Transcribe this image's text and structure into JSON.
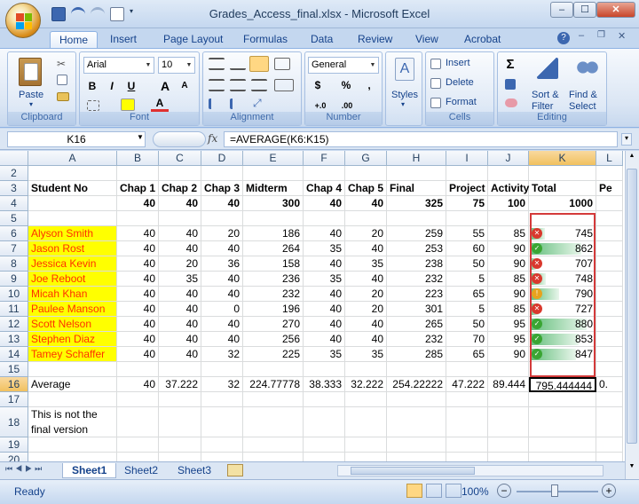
{
  "window": {
    "title": "Grades_Access_final.xlsx - Microsoft Excel",
    "minimize": "–",
    "maximize": "☐",
    "close": "✕"
  },
  "ribbon_tabs": [
    "Home",
    "Insert",
    "Page Layout",
    "Formulas",
    "Data",
    "Review",
    "View",
    "Acrobat"
  ],
  "ribbon": {
    "clipboard": {
      "paste": "Paste",
      "label": "Clipboard"
    },
    "font": {
      "name": "Arial",
      "size": "10",
      "label": "Font",
      "bold": "B",
      "italic": "I",
      "underline": "U",
      "grow": "A",
      "shrink": "A",
      "color_letter": "A"
    },
    "alignment": {
      "label": "Alignment"
    },
    "number": {
      "format": "General",
      "currency": "$",
      "percent": "%",
      "comma": ",",
      "inc": "+.0",
      "dec": ".00",
      "label": "Number"
    },
    "styles": {
      "styles": "Styles"
    },
    "cells": {
      "insert": "Insert",
      "delete": "Delete",
      "format": "Format",
      "label": "Cells"
    },
    "editing": {
      "sigma": "Σ",
      "sort": "Sort &",
      "sort2": "Filter",
      "find": "Find &",
      "find2": "Select",
      "label": "Editing"
    }
  },
  "formula_bar": {
    "name_box": "K16",
    "fx": "fx",
    "formula": "=AVERAGE(K6:K15)"
  },
  "columns": [
    "A",
    "B",
    "C",
    "D",
    "E",
    "F",
    "G",
    "H",
    "I",
    "J",
    "K",
    "L"
  ],
  "rows": [
    "2",
    "3",
    "4",
    "5",
    "6",
    "7",
    "8",
    "9",
    "10",
    "11",
    "12",
    "13",
    "14",
    "15",
    "16",
    "17",
    "18",
    "19",
    "20"
  ],
  "header_row": {
    "student": "Student No",
    "c1": "Chap 1",
    "c2": "Chap 2",
    "c3": "Chap 3",
    "mid": "Midterm",
    "c4": "Chap 4",
    "c5": "Chap 5",
    "final": "Final",
    "proj": "Project",
    "act": "Activity",
    "total": "Total",
    "pe": "Pe"
  },
  "max_row": [
    "40",
    "40",
    "40",
    "300",
    "40",
    "40",
    "325",
    "75",
    "100",
    "1000"
  ],
  "students": [
    {
      "name": "Alyson Smith",
      "v": [
        "40",
        "40",
        "20",
        "186",
        "40",
        "20",
        "259",
        "55",
        "85",
        "745"
      ],
      "icon": "red"
    },
    {
      "name": "Jason Rost",
      "v": [
        "40",
        "40",
        "40",
        "264",
        "35",
        "40",
        "253",
        "60",
        "90",
        "862"
      ],
      "icon": "green"
    },
    {
      "name": "Jessica Kevin",
      "v": [
        "40",
        "20",
        "36",
        "158",
        "40",
        "35",
        "238",
        "50",
        "90",
        "707"
      ],
      "icon": "red"
    },
    {
      "name": "Joe Reboot",
      "v": [
        "40",
        "35",
        "40",
        "236",
        "35",
        "40",
        "232",
        "5",
        "85",
        "748"
      ],
      "icon": "red"
    },
    {
      "name": "Micah Khan",
      "v": [
        "40",
        "40",
        "40",
        "232",
        "40",
        "20",
        "223",
        "65",
        "90",
        "790"
      ],
      "icon": "yellow"
    },
    {
      "name": "Paulee Manson",
      "v": [
        "40",
        "40",
        "0",
        "196",
        "40",
        "20",
        "301",
        "5",
        "85",
        "727"
      ],
      "icon": "red"
    },
    {
      "name": "Scott Nelson",
      "v": [
        "40",
        "40",
        "40",
        "270",
        "40",
        "40",
        "265",
        "50",
        "95",
        "880"
      ],
      "icon": "green"
    },
    {
      "name": "Stephen Diaz",
      "v": [
        "40",
        "40",
        "40",
        "256",
        "40",
        "40",
        "232",
        "70",
        "95",
        "853"
      ],
      "icon": "green"
    },
    {
      "name": "Tamey Schaffer",
      "v": [
        "40",
        "40",
        "32",
        "225",
        "35",
        "35",
        "285",
        "65",
        "90",
        "847"
      ],
      "icon": "green"
    }
  ],
  "average_row": {
    "label": "Average",
    "v": [
      "40",
      "37.222",
      "32",
      "224.77778",
      "38.333",
      "32.222",
      "254.22222",
      "47.222",
      "89.444",
      "795.444444"
    ],
    "pe": "0."
  },
  "note": {
    "line1": "This is not the",
    "line2": "final version"
  },
  "sheets": [
    "Sheet1",
    "Sheet2",
    "Sheet3"
  ],
  "status": {
    "ready": "Ready",
    "zoom": "100%",
    "minus": "−",
    "plus": "+"
  },
  "colors": {
    "ribbon": "#dbe6f4",
    "highlight": "#ffff00",
    "name_text": "#ff3000",
    "databar": "#63be7b",
    "selection_border": "#d43a3a"
  }
}
